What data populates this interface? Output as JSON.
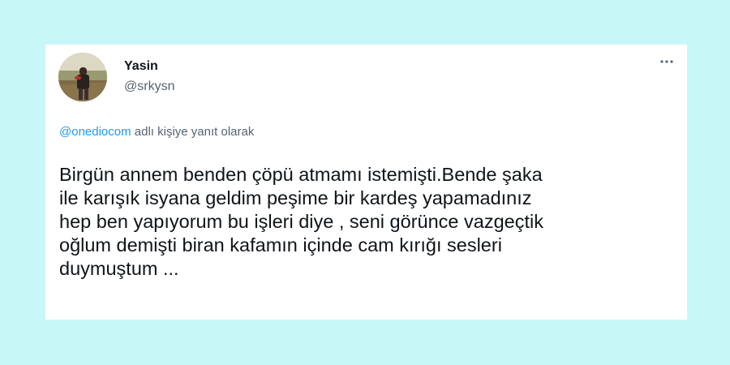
{
  "tweet": {
    "author": {
      "display_name": "Yasin",
      "handle": "@srkysn",
      "avatar_icon": "user-photo-avatar"
    },
    "more_icon": "more-horizontal-icon",
    "reply_context": {
      "mention": "@onediocom",
      "suffix": " adlı kişiye yanıt olarak"
    },
    "text": "Birgün annem benden çöpü atmamı istemişti.Bende şaka\nile karışık isyana geldim peşime bir kardeş yapamadınız\nhep ben yapıyorum bu işleri diye , seni görünce vazgeçtik\noğlum demişti biran kafamın içinde cam kırığı sesleri\nduymuştum ..."
  },
  "colors": {
    "background": "#c8f7f7",
    "card": "#ffffff",
    "text_primary": "#0f1419",
    "text_secondary": "#536471",
    "link": "#1d9bf0"
  }
}
